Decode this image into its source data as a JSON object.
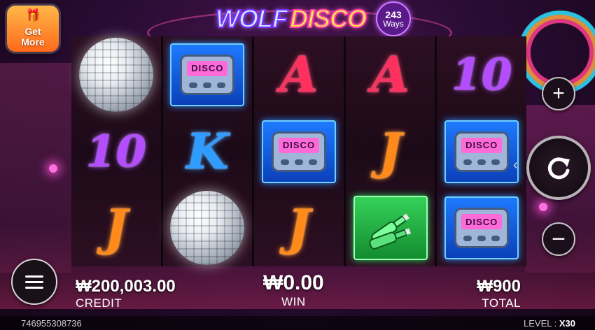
{
  "game": {
    "logo_part1": "WOLF",
    "logo_part2": "DISCO",
    "ways_number": "243",
    "ways_text": "Ways"
  },
  "promo": {
    "get_more_line1": "Get",
    "get_more_line2": "More"
  },
  "reels": [
    [
      "disco-ball",
      "10",
      "J"
    ],
    [
      "pager",
      "K",
      "disco-ball"
    ],
    [
      "A",
      "pager",
      "J"
    ],
    [
      "A",
      "J",
      "bottles"
    ],
    [
      "10",
      "pager",
      "pager"
    ]
  ],
  "pager_screen_text": "DISCO",
  "symbol_colors": {
    "A": "#ff2f5e",
    "K": "#2f9cff",
    "J": "#ff8a1a",
    "10": "#b34dff"
  },
  "controls": {
    "bet_plus_icon": "plus-icon",
    "bet_minus_icon": "minus-icon",
    "spin_icon": "refresh-icon",
    "menu_icon": "hamburger-menu-icon"
  },
  "credit": {
    "value": "₩200,003.00",
    "label": "CREDIT"
  },
  "win": {
    "value": "₩0.00",
    "label": "WIN"
  },
  "total": {
    "value": "₩900",
    "label": "TOTAL"
  },
  "footer": {
    "session_id": "746955308736",
    "level_label": "LEVEL :",
    "level_value": "X30"
  }
}
